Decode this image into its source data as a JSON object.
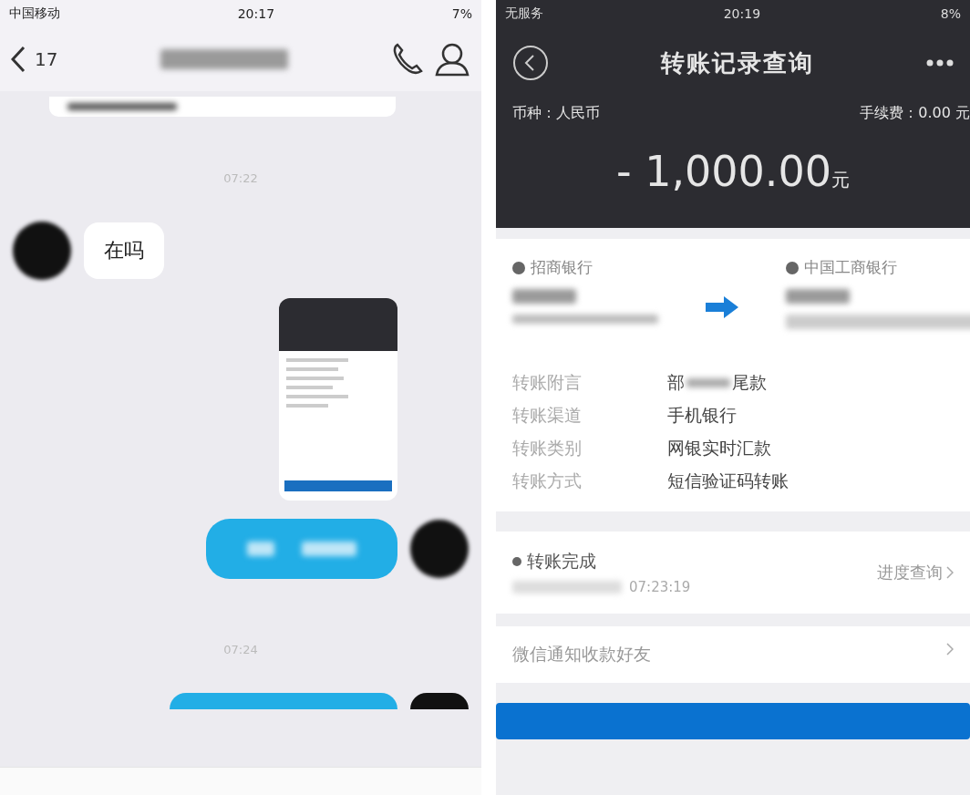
{
  "chat_phone": {
    "status_bar": {
      "carrier": "中国移动",
      "time": "20:17",
      "battery": "7%"
    },
    "nav": {
      "back_count": "17"
    },
    "messages": [
      {
        "kind": "timestamp",
        "text": "07:22"
      },
      {
        "kind": "incoming",
        "text": "在吗"
      },
      {
        "kind": "image"
      },
      {
        "kind": "outgoing"
      },
      {
        "kind": "timestamp",
        "text": "07:24"
      },
      {
        "kind": "outgoing_partial"
      }
    ]
  },
  "bank_phone": {
    "status_bar": {
      "carrier": "无服务",
      "time": "20:19",
      "battery": "8%"
    },
    "title": "转账记录查询",
    "currency": "币种：人民币",
    "fee": "手续费：0.00 元",
    "amount": "- 1,000.00",
    "amount_unit": "元",
    "from_bank": "招商银行",
    "to_bank": "中国工商银行",
    "fields": [
      {
        "label": "转账附言",
        "prefix": "部",
        "redacted": true,
        "value": "尾款"
      },
      {
        "label": "转账渠道",
        "redacted": false,
        "value": "手机银行"
      },
      {
        "label": "转账类别",
        "redacted": false,
        "value": "网银实时汇款"
      },
      {
        "label": "转账方式",
        "redacted": false,
        "value": "短信验证码转账"
      }
    ],
    "status": {
      "text": "转账完成",
      "time": "07:23:19",
      "link": "进度查询"
    },
    "notify": "微信通知收款好友"
  }
}
